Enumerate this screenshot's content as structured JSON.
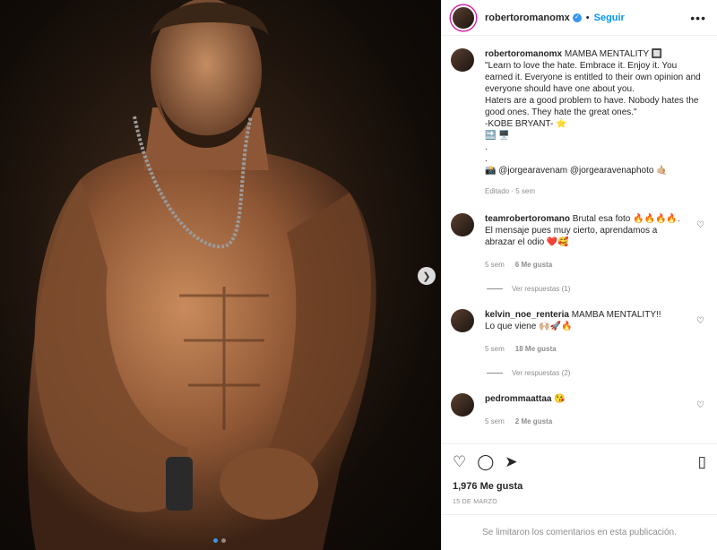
{
  "media": {
    "next_icon": "chevron-right-icon",
    "carousel_count": 2,
    "carousel_active": 1
  },
  "header": {
    "username": "robertoromanomx",
    "separator": "•",
    "follow_label": "Seguir",
    "more_label": "•••"
  },
  "caption": {
    "username": "robertoromanomx",
    "text": "MAMBA MENTALITY 🔲\n\"Learn to love the hate. Embrace it. Enjoy it. You earned it. Everyone is entitled to their own opinion and everyone should have one about you.\nHaters are a good problem to have. Nobody hates the good ones. They hate the great ones.\"\n-KOBE BRYANT- ⭐\n🔜 🖥️\n.\n.\n📸 @jorgearavenam @jorgearavenaphoto 🤙🏼",
    "meta": "Editado · 5 sem"
  },
  "comments": [
    {
      "username": "teamrobertoromano",
      "text": "Brutal esa foto 🔥🔥🔥🔥. El mensaje pues muy cierto, aprendamos a abrazar el odio ❤️🥰",
      "time": "5 sem",
      "likes": "6 Me gusta",
      "replies": "Ver respuestas (1)"
    },
    {
      "username": "kelvin_noe_renteria",
      "text": "MAMBA MENTALITY!!\nLo que viene 🙌🏼🚀🔥",
      "time": "5 sem",
      "likes": "18 Me gusta",
      "replies": "Ver respuestas (2)"
    },
    {
      "username": "pedrommaattaa",
      "text": "😘",
      "time": "5 sem",
      "likes": "2 Me gusta",
      "replies": ""
    }
  ],
  "actions": {
    "like_icon": "♡",
    "comment_icon": "◯",
    "share_icon": "➤",
    "save_icon": "▯"
  },
  "likes_count": "1,976 Me gusta",
  "date": "15 DE MARZO",
  "footer_text": "Se limitaron los comentarios en esta publicación."
}
